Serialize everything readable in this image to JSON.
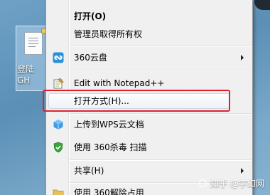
{
  "desktop": {
    "icon_label_line1": "登陆",
    "icon_label_line2": "GH"
  },
  "context_menu": {
    "items": [
      {
        "label": "打开(O)",
        "bold": true
      },
      {
        "label": "管理员取得所有权"
      },
      {
        "label": "360云盘",
        "submenu": true,
        "icon": "cloud-icon"
      },
      {
        "label": "Edit with Notepad++",
        "icon": "notepad-icon"
      },
      {
        "label": "打开方式(H)...",
        "highlighted": true
      },
      {
        "label": "上传到WPS云文档",
        "icon": "wps-cloud-icon"
      },
      {
        "label": "使用 360杀毒 扫描",
        "icon": "shield-icon"
      },
      {
        "label": "共享(H)",
        "submenu": true
      },
      {
        "label": "使用 360解除占用",
        "icon": "folder-icon"
      }
    ]
  },
  "watermark": {
    "text": "知乎 @字幻网"
  },
  "colors": {
    "menu_bg": "#f0f0f0",
    "highlight_border": "#e2202c",
    "desktop_bg": "#6fa1c6"
  }
}
